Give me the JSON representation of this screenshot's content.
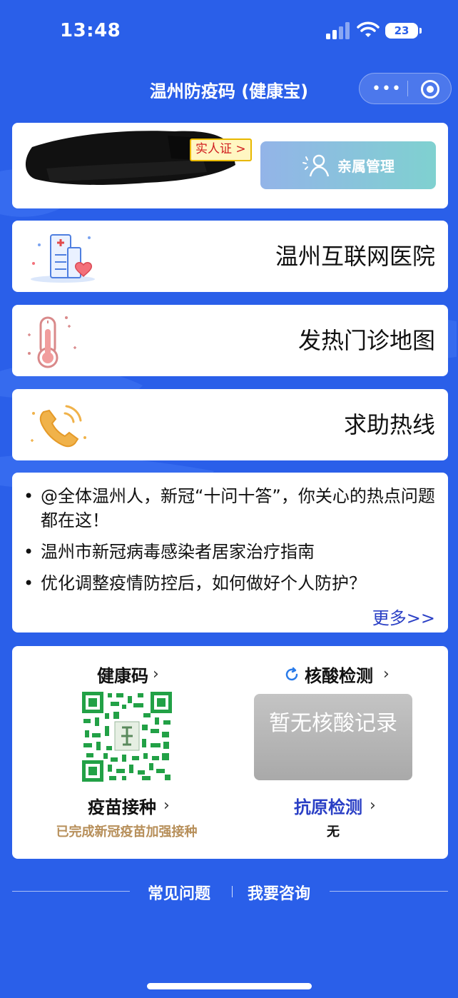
{
  "status_bar": {
    "time": "13:48",
    "battery": "23"
  },
  "nav": {
    "title": "温州防疫码 (健康宝)"
  },
  "user": {
    "verify_tag": "实人证 >",
    "family_button": "亲属管理"
  },
  "services": [
    {
      "label": "温州互联网医院",
      "icon": "hospital-icon"
    },
    {
      "label": "发热门诊地图",
      "icon": "thermometer-icon"
    },
    {
      "label": "求助热线",
      "icon": "phone-icon"
    }
  ],
  "news": {
    "items": [
      "@全体温州人，新冠“十问十答”，你关心的热点问题都在这！",
      "温州市新冠病毒感染者居家治疗指南",
      "优化调整疫情防控后，如何做好个人防护？"
    ],
    "more": "更多>>"
  },
  "health": {
    "health_code_title": "健康码",
    "nat_title": "核酸检测",
    "nat_empty": "暂无核酸记录",
    "vaccine_title": "疫苗接种",
    "vaccine_status": "已完成新冠疫苗加强接种",
    "antigen_title": "抗原检测",
    "antigen_value": "无",
    "chevron": "›"
  },
  "footer": {
    "faq": "常见问题",
    "consult": "我要咨询"
  },
  "colors": {
    "background": "#2a5fe9",
    "link_blue": "#2a3fc5",
    "vaccine_gold": "#b78f5a",
    "qr_green": "#22a146"
  }
}
